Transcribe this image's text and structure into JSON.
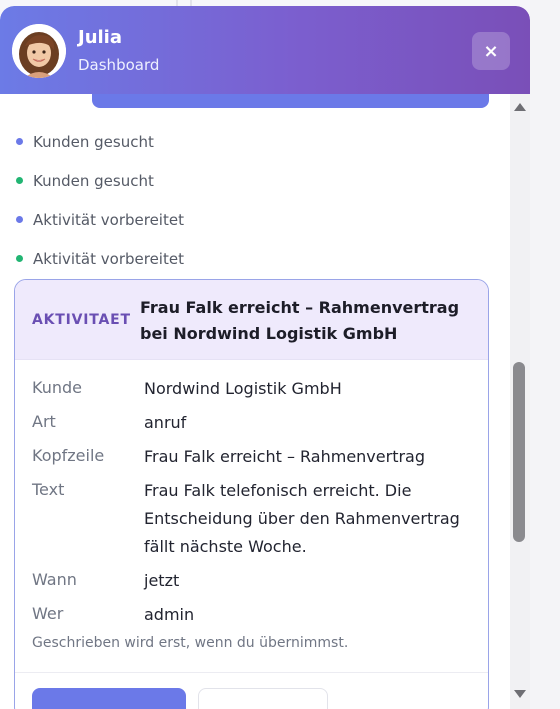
{
  "header": {
    "name": "Julia",
    "subtitle": "Dashboard",
    "close_label": "×"
  },
  "status": [
    {
      "text": "Kunden gesucht",
      "color": "#6b79e8"
    },
    {
      "text": "Kunden gesucht",
      "color": "#22b573"
    },
    {
      "text": "Aktivität vorbereitet",
      "color": "#6b79e8"
    },
    {
      "text": "Aktivität vorbereitet",
      "color": "#22b573"
    }
  ],
  "card": {
    "badge": "AKTIVITAET",
    "title": "Frau Falk erreicht – Rahmenvertrag bei Nordwind Logistik GmbH",
    "rows": [
      {
        "label": "Kunde",
        "value": "Nordwind Logistik GmbH"
      },
      {
        "label": "Art",
        "value": "anruf"
      },
      {
        "label": "Kopfzeile",
        "value": "Frau Falk erreicht – Rahmenvertrag"
      },
      {
        "label": "Text",
        "value": "Frau Falk telefonisch erreicht. Die Entscheidung über den Rahmenvertrag fällt nächste Woche."
      },
      {
        "label": "Wann",
        "value": "jetzt"
      },
      {
        "label": "Wer",
        "value": "admin"
      }
    ],
    "note": "Geschrieben wird erst, wenn du übernimmst."
  },
  "colors": {
    "accent": "#6b79e8",
    "success": "#22b573",
    "badge": "#6a4fb3"
  }
}
